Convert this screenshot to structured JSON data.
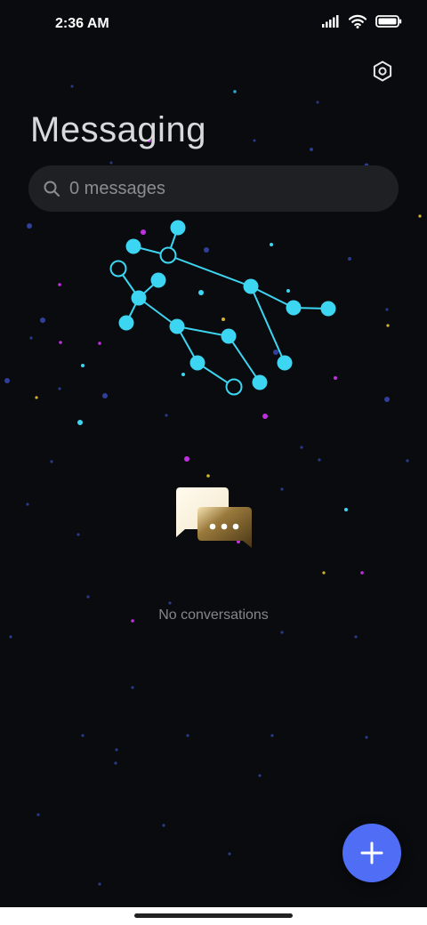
{
  "status_bar": {
    "time": "2:36 AM",
    "icons": [
      "signal-icon",
      "wifi-icon",
      "battery-icon"
    ]
  },
  "header": {
    "title": "Messaging",
    "settings_icon": "gear-icon"
  },
  "search": {
    "icon": "search-icon",
    "text": "0 messages"
  },
  "empty_state": {
    "illustration": "chat-bubbles-icon",
    "message": "No conversations"
  },
  "fab": {
    "icon": "plus-icon"
  },
  "colors": {
    "background": "#0a0b0e",
    "accent": "#4f6ef5",
    "constellation": "#3dd6f2",
    "search_bg": "#1f2024"
  }
}
